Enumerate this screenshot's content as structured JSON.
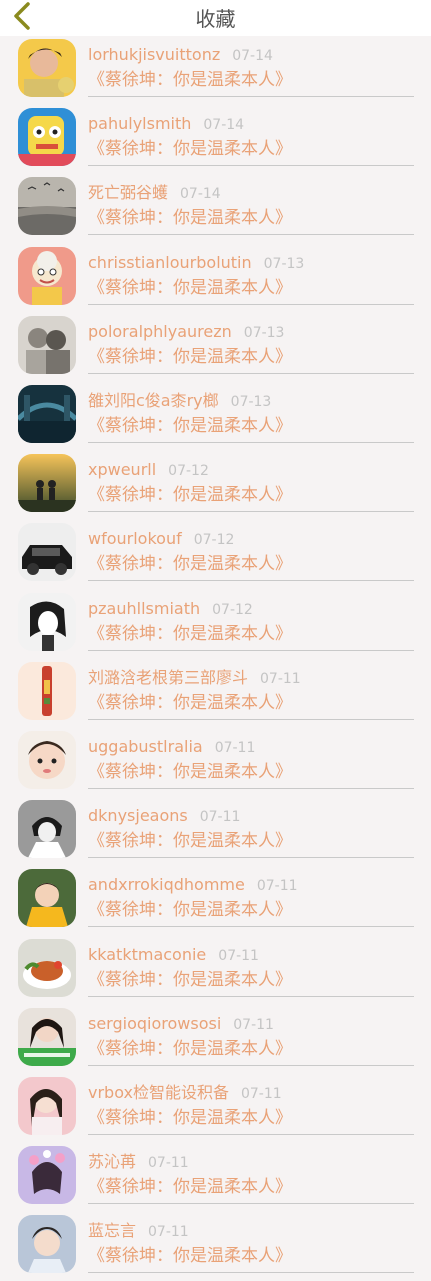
{
  "header": {
    "title": "收藏",
    "back_icon": "chevron-left-icon",
    "back_color": "#8a8a1e"
  },
  "colors": {
    "accent": "#e9a277",
    "date": "#c4c4c4",
    "background": "#f6f3f3"
  },
  "items": [
    {
      "name": "lorhukjisvuittonz",
      "date": "07-14",
      "subtitle": "《蔡徐坤：你是温柔本人》",
      "avatar": "avatar-boy-yellow"
    },
    {
      "name": "pahulylsmith",
      "date": "07-14",
      "subtitle": "《蔡徐坤：你是温柔本人》",
      "avatar": "avatar-cartoon-robot"
    },
    {
      "name": "死亡弼谷蠖",
      "date": "07-14",
      "subtitle": "《蔡徐坤：你是温柔本人》",
      "avatar": "avatar-seascape-birds"
    },
    {
      "name": "chrisstianlourbolutin",
      "date": "07-13",
      "subtitle": "《蔡徐坤：你是温柔本人》",
      "avatar": "avatar-cartoon-grandma"
    },
    {
      "name": "poloralphlyaurezn",
      "date": "07-13",
      "subtitle": "《蔡徐坤：你是温柔本人》",
      "avatar": "avatar-couple-sketch"
    },
    {
      "name": "雒刘阳c俊a桼ry榔",
      "date": "07-13",
      "subtitle": "《蔡徐坤：你是温柔本人》",
      "avatar": "avatar-bridge-night"
    },
    {
      "name": "xpweurll",
      "date": "07-12",
      "subtitle": "《蔡徐坤：你是温柔本人》",
      "avatar": "avatar-sunset-silhouette"
    },
    {
      "name": "wfourlokouf",
      "date": "07-12",
      "subtitle": "《蔡徐坤：你是温柔本人》",
      "avatar": "avatar-black-car"
    },
    {
      "name": "pzauhllsmiath",
      "date": "07-12",
      "subtitle": "《蔡徐坤：你是温柔本人》",
      "avatar": "avatar-anime-girl-bw"
    },
    {
      "name": "刘潞浛老根第三部廖斗",
      "date": "07-11",
      "subtitle": "《蔡徐坤：你是温柔本人》",
      "avatar": "avatar-red-bottle"
    },
    {
      "name": "uggabustlralia",
      "date": "07-11",
      "subtitle": "《蔡徐坤：你是温柔本人》",
      "avatar": "avatar-baby-face"
    },
    {
      "name": "dknysjeaons",
      "date": "07-11",
      "subtitle": "《蔡徐坤：你是温柔本人》",
      "avatar": "avatar-anime-boy-bw"
    },
    {
      "name": "andxrrokiqdhomme",
      "date": "07-11",
      "subtitle": "《蔡徐坤：你是温柔本人》",
      "avatar": "avatar-kid-yellow"
    },
    {
      "name": "kkatktmaconie",
      "date": "07-11",
      "subtitle": "《蔡徐坤：你是温柔本人》",
      "avatar": "avatar-food-dish"
    },
    {
      "name": "sergioqiorowsosi",
      "date": "07-11",
      "subtitle": "《蔡徐坤：你是温柔本人》",
      "avatar": "avatar-girl-green-banner"
    },
    {
      "name": "vrbox检智能设积备",
      "date": "07-11",
      "subtitle": "《蔡徐坤：你是温柔本人》",
      "avatar": "avatar-girl-pink"
    },
    {
      "name": "苏沁苒",
      "date": "07-11",
      "subtitle": "《蔡徐坤：你是温柔本人》",
      "avatar": "avatar-girl-flowers"
    },
    {
      "name": "蓝忘言",
      "date": "07-11",
      "subtitle": "《蔡徐坤：你是温柔本人》",
      "avatar": "avatar-boy-portrait"
    }
  ]
}
